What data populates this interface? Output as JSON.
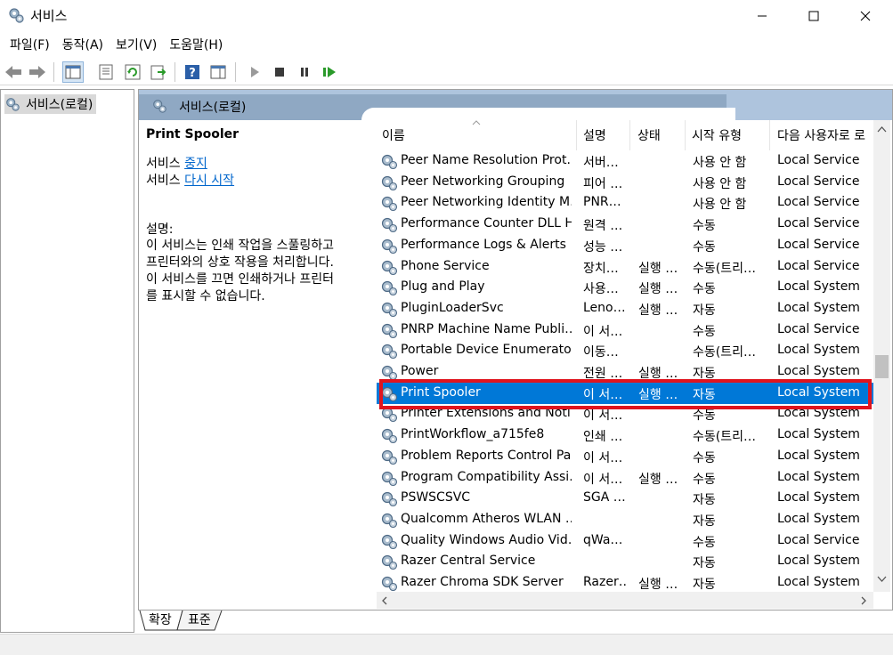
{
  "window": {
    "title": "서비스",
    "icon": "services-gear-icon"
  },
  "menu": [
    "파일(F)",
    "동작(A)",
    "보기(V)",
    "도움말(H)"
  ],
  "tree": {
    "node_label": "서비스(로컬)"
  },
  "right_header": {
    "title": "서비스(로컬)"
  },
  "description": {
    "service_name": "Print Spooler",
    "action1_prefix": "서비스",
    "action1_link": "중지",
    "action2_prefix": "서비스",
    "action2_link": "다시 시작",
    "desc_label": "설명:",
    "desc_lines": [
      "이 서비스는 인쇄 작업을 스풀링하고",
      "프린터와의 상호 작용을 처리합니다.",
      "이 서비스를 끄면 인쇄하거나 프린터",
      "를 표시할 수 없습니다."
    ]
  },
  "columns": {
    "name": "이름",
    "description": "설명",
    "status": "상태",
    "startup": "시작 유형",
    "logon": "다음 사용자로 로"
  },
  "services": [
    {
      "name": "Peer Name Resolution Prot…",
      "desc": "서버…",
      "status": "",
      "startup": "사용 안 함",
      "logon": "Local Service"
    },
    {
      "name": "Peer Networking Grouping",
      "desc": "피어 …",
      "status": "",
      "startup": "사용 안 함",
      "logon": "Local Service"
    },
    {
      "name": "Peer Networking Identity M…",
      "desc": "PNR…",
      "status": "",
      "startup": "사용 안 함",
      "logon": "Local Service"
    },
    {
      "name": "Performance Counter DLL H…",
      "desc": "원격 …",
      "status": "",
      "startup": "수동",
      "logon": "Local Service"
    },
    {
      "name": "Performance Logs & Alerts",
      "desc": "성능 …",
      "status": "",
      "startup": "수동",
      "logon": "Local Service"
    },
    {
      "name": "Phone Service",
      "desc": "장치…",
      "status": "실행 …",
      "startup": "수동(트리…",
      "logon": "Local Service"
    },
    {
      "name": "Plug and Play",
      "desc": "사용…",
      "status": "실행 …",
      "startup": "수동",
      "logon": "Local System"
    },
    {
      "name": "PluginLoaderSvc",
      "desc": "Leno…",
      "status": "실행 …",
      "startup": "자동",
      "logon": "Local System"
    },
    {
      "name": "PNRP Machine Name Publi…",
      "desc": "이 서…",
      "status": "",
      "startup": "수동",
      "logon": "Local Service"
    },
    {
      "name": "Portable Device Enumerator…",
      "desc": "이동…",
      "status": "",
      "startup": "수동(트리…",
      "logon": "Local System"
    },
    {
      "name": "Power",
      "desc": "전원 …",
      "status": "실행 …",
      "startup": "자동",
      "logon": "Local System"
    },
    {
      "name": "Print Spooler",
      "desc": "이 서…",
      "status": "실행 …",
      "startup": "자동",
      "logon": "Local System",
      "selected": true
    },
    {
      "name": "Printer Extensions and Noti…",
      "desc": "이 서…",
      "status": "",
      "startup": "수동",
      "logon": "Local System"
    },
    {
      "name": "PrintWorkflow_a715fe8",
      "desc": "인쇄 …",
      "status": "",
      "startup": "수동(트리…",
      "logon": "Local System"
    },
    {
      "name": "Problem Reports Control Pa…",
      "desc": "이 서…",
      "status": "",
      "startup": "수동",
      "logon": "Local System"
    },
    {
      "name": "Program Compatibility Assi…",
      "desc": "이 서…",
      "status": "실행 …",
      "startup": "수동",
      "logon": "Local System"
    },
    {
      "name": "PSWSCSVC",
      "desc": "SGA …",
      "status": "",
      "startup": "자동",
      "logon": "Local System"
    },
    {
      "name": "Qualcomm Atheros WLAN …",
      "desc": "",
      "status": "",
      "startup": "자동",
      "logon": "Local System"
    },
    {
      "name": "Quality Windows Audio Vid…",
      "desc": "qWa…",
      "status": "",
      "startup": "수동",
      "logon": "Local Service"
    },
    {
      "name": "Razer Central Service",
      "desc": "",
      "status": "",
      "startup": "자동",
      "logon": "Local System"
    },
    {
      "name": "Razer Chroma SDK Server",
      "desc": "Razer…",
      "status": "실행 …",
      "startup": "자동",
      "logon": "Local System"
    }
  ],
  "bottom_tabs": [
    "확장",
    "표준"
  ],
  "colors": {
    "selection": "#0078d7",
    "highlight_box": "#e0141e",
    "header_bg": "#aec4dd",
    "link": "#0066cc"
  }
}
